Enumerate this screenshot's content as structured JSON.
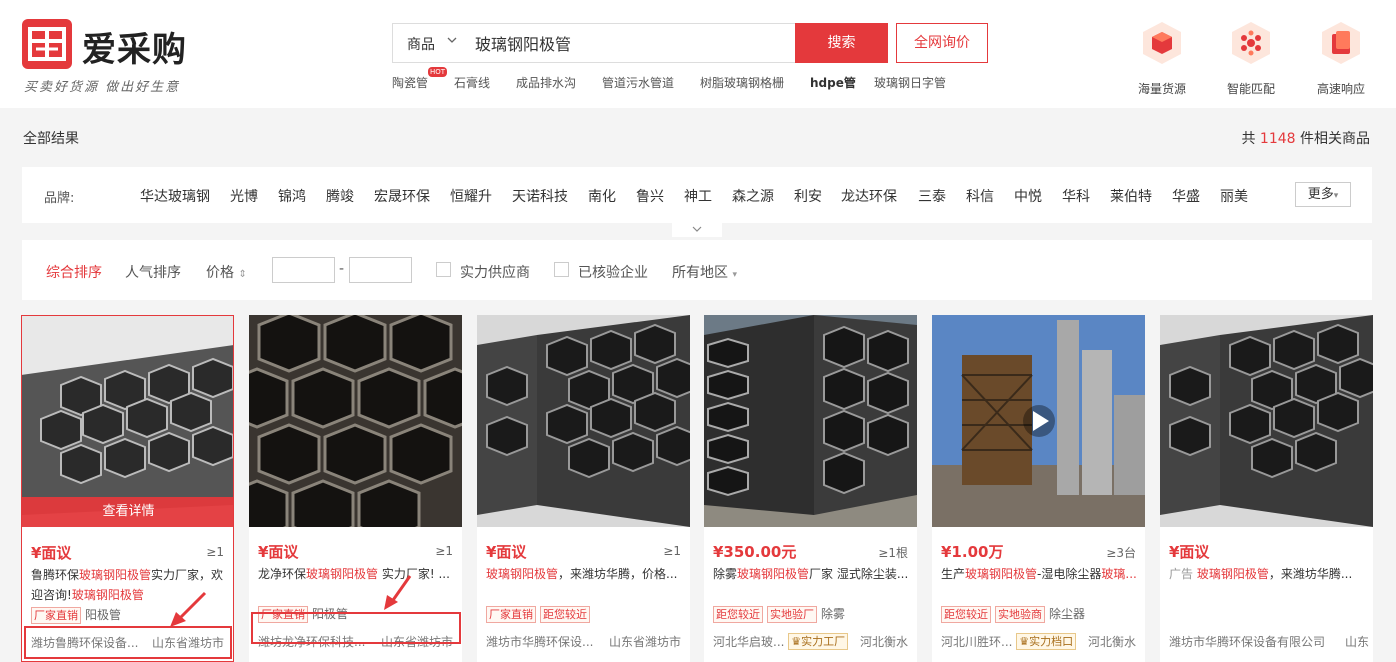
{
  "header": {
    "logo_name": "爱采购",
    "logo_slogan": "买卖好货源 做出好生意",
    "search": {
      "category": "商品",
      "query": "玻璃钢阳极管",
      "button": "搜索",
      "inquiry": "全网询价"
    },
    "hot_badge": "HOT",
    "hot_words": [
      "陶瓷管",
      "石膏线",
      "成品排水沟",
      "管道污水管道",
      "树脂玻璃钢格栅",
      "hdpe管",
      "玻璃钢日字管"
    ],
    "features": [
      {
        "label": "海量货源",
        "icon": "box-icon"
      },
      {
        "label": "智能匹配",
        "icon": "match-icon"
      },
      {
        "label": "高速响应",
        "icon": "speed-icon"
      }
    ]
  },
  "results": {
    "label": "全部结果",
    "prefix": "共",
    "count": "1148",
    "suffix": "件相关商品"
  },
  "brand_filter": {
    "label": "品牌:",
    "items": [
      "华达玻璃钢",
      "光博",
      "锦鸿",
      "腾竣",
      "宏晟环保",
      "恒耀升",
      "天诺科技",
      "南化",
      "鲁兴",
      "神工",
      "森之源",
      "利安",
      "龙达环保",
      "三泰",
      "科信",
      "中悦",
      "华科",
      "莱伯特",
      "华盛",
      "丽美"
    ],
    "more": "更多",
    "more_arrow": "▾",
    "expand_icon": "⌄"
  },
  "sort_bar": {
    "composite": "综合排序",
    "popularity": "人气排序",
    "price": "价格",
    "price_icon": "⇕",
    "dash": "-",
    "strong_supplier": "实力供应商",
    "verified": "已核验企业",
    "region": "所有地区",
    "region_arrow": "▾"
  },
  "products": [
    {
      "price": "¥面议",
      "moq": "≥1",
      "title_pre": "鲁腾环保",
      "title_hl": "玻璃钢阳极管",
      "title_post": "实力厂家，欢迎咨询!",
      "title_hl2": "玻璃钢阳极管",
      "tags": [
        "厂家直销"
      ],
      "plain": "阳极管",
      "company": "潍坊鲁腾环保设备...",
      "location": "山东省潍坊市",
      "detail": "查看详情"
    },
    {
      "price": "¥面议",
      "moq": "≥1",
      "title_pre": "龙净环保",
      "title_hl": "玻璃钢阳极管",
      "title_post": " 实力厂家! ...",
      "tags": [
        "厂家直销"
      ],
      "plain": "阳极管",
      "company": "潍坊龙净环保科技...",
      "location": "山东省潍坊市"
    },
    {
      "price": "¥面议",
      "moq": "≥1",
      "title_pre": "",
      "title_hl": "玻璃钢阳极管",
      "title_post": "，来潍坊华腾，价格...",
      "tags": [
        "厂家直销",
        "距您较近"
      ],
      "company": "潍坊市华腾环保设...",
      "location": "山东省潍坊市"
    },
    {
      "price": "¥350.00元",
      "moq": "≥1根",
      "title_pre": "除雾",
      "title_hl": "玻璃钢阳极管",
      "title_post": "厂家 湿式除尘装...",
      "tags": [
        "距您较近",
        "实地验厂"
      ],
      "plain": "除雾",
      "company": "河北华启玻...",
      "gold": "实力工厂",
      "location": "河北衡水"
    },
    {
      "price": "¥1.00万",
      "moq": "≥3台",
      "title_pre": "生产",
      "title_hl": "玻璃钢阳极管",
      "title_post": "-湿电除尘器",
      "title_hl2": "玻璃...",
      "tags": [
        "距您较近",
        "实地验商"
      ],
      "plain": "除尘器",
      "company": "河北川胜环...",
      "gold": "实力档口",
      "location": "河北衡水"
    },
    {
      "price": "¥面议",
      "moq": "",
      "ad": "广告",
      "title_pre": "",
      "title_hl": "玻璃钢阳极管",
      "title_post": "，来潍坊华腾...",
      "tags": [],
      "company": "潍坊市华腾环保设备有限公司",
      "location": "山东"
    }
  ]
}
